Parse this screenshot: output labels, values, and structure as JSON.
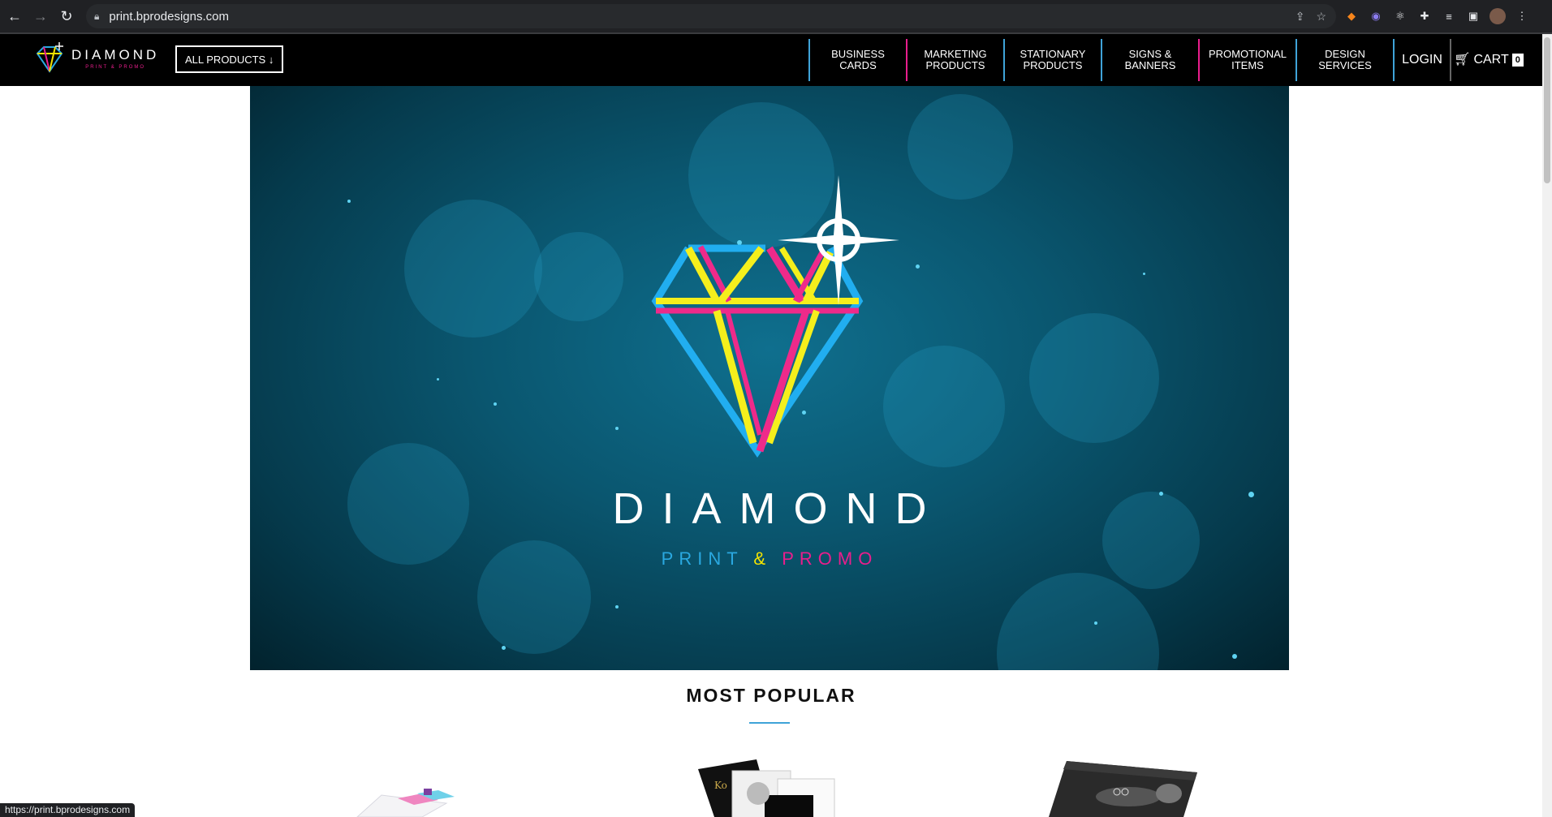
{
  "browser": {
    "url": "print.bprodesigns.com",
    "status_url": "https://print.bprodesigns.com"
  },
  "header": {
    "logo_word": "DIAMOND",
    "logo_sub": "PRINT & PROMO",
    "all_products_label": "ALL PRODUCTS ↓",
    "nav": [
      {
        "line1": "BUSINESS",
        "line2": "CARDS"
      },
      {
        "line1": "MARKETING",
        "line2": "PRODUCTS"
      },
      {
        "line1": "STATIONARY",
        "line2": "PRODUCTS"
      },
      {
        "line1": "SIGNS &",
        "line2": "BANNERS"
      },
      {
        "line1": "PROMOTIONAL",
        "line2": "ITEMS"
      },
      {
        "line1": "DESIGN",
        "line2": "SERVICES"
      }
    ],
    "login_label": "LOGIN",
    "cart_label": "CART",
    "cart_count": "0"
  },
  "hero": {
    "title": "DIAMOND",
    "sub_part1": "PRINT",
    "sub_amp": "&",
    "sub_part2": "PROMO"
  },
  "popular": {
    "title": "MOST POPULAR"
  },
  "colors": {
    "accent_blue": "#3fa3d8",
    "accent_pink": "#e91e8c",
    "accent_yellow": "#f5e400",
    "header_bg": "#000000"
  }
}
